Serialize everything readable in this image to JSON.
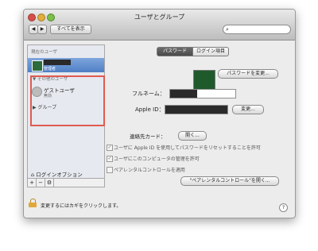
{
  "window": {
    "title": "ユーザとグループ"
  },
  "toolbar": {
    "back_glyph": "◀",
    "forward_glyph": "▶",
    "show_all_label": "すべてを表示",
    "search_icon": "search-icon",
    "search_glyph": "⌕"
  },
  "sidebar": {
    "current_user_header": "現在のユーザ",
    "current_user_role": "管理者",
    "other_users_header": "▼ その他のユーザ",
    "guest_name": "ゲストユーザ",
    "guest_status": "無効",
    "group_label": "▶ グループ",
    "login_options_label": "ログインオプション",
    "login_options_icon": "house-icon",
    "tools": [
      "+",
      "−",
      "⚙"
    ]
  },
  "main": {
    "tabs": [
      {
        "label": "パスワード",
        "selected": true
      },
      {
        "label": "ログイン項目",
        "selected": false
      }
    ],
    "change_password_button": "パスワードを変更...",
    "full_name_label": "フルネーム：",
    "apple_id_label": "Apple ID：",
    "apple_id_change_button": "変更...",
    "address_card_label": "連絡先カード：",
    "open_button": "開く...",
    "checkbox_reset_password": "ユーザに Apple ID を使用してパスワードをリセットすることを許可",
    "checkbox_admin": "ユーザにこのコンピュータの管理を許可",
    "checkbox_parental": "ペアレンタルコントロールを適用",
    "parental_open_button": "\"ペアレンタルコントロール\"を開く...",
    "check_mark": "✓"
  },
  "footer": {
    "lock_text": "変更するにはカギをクリックします。",
    "help_glyph": "?"
  },
  "colors": {
    "highlight_box": "#e05a50",
    "selected_row": "#5e8bd0"
  }
}
